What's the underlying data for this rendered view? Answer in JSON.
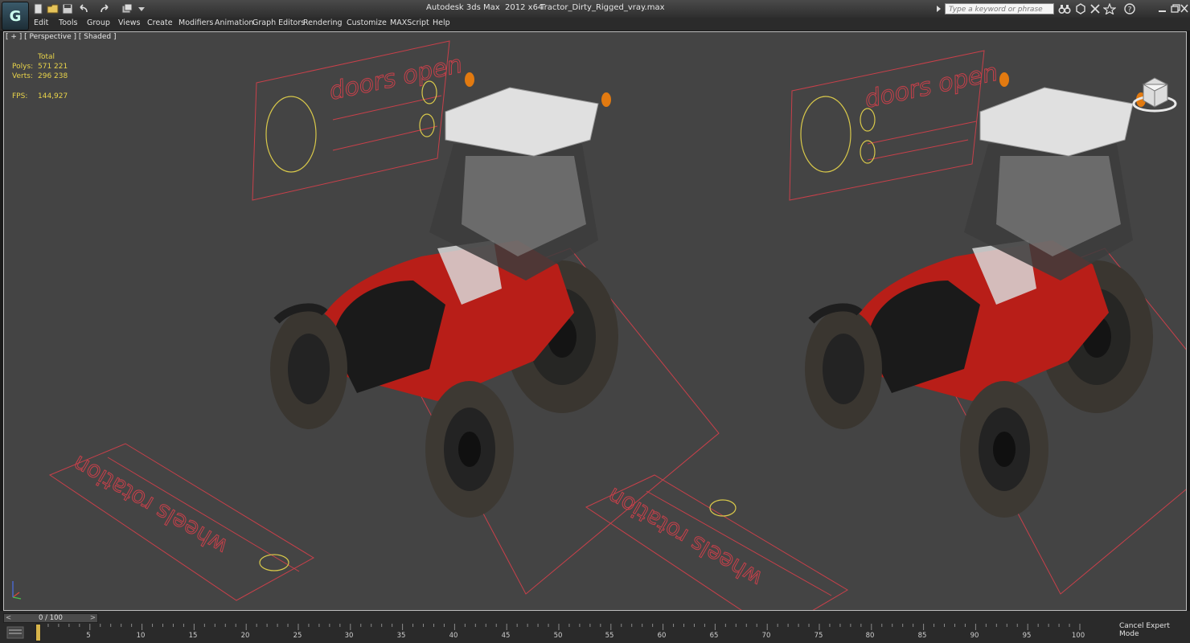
{
  "title": {
    "app": "Autodesk 3ds Max  2012 x64",
    "file": "Tractor_Dirty_Rigged_vray.max",
    "search_placeholder": "Type a keyword or phrase"
  },
  "menu": [
    "Edit",
    "Tools",
    "Group",
    "Views",
    "Create",
    "Modifiers",
    "Animation",
    "Graph Editors",
    "Rendering",
    "Customize",
    "MAXScript",
    "Help"
  ],
  "viewport": {
    "label": "[ + ] [ Perspective ] [ Shaded ]",
    "stats": {
      "total_label": "Total",
      "polys_label": "Polys:",
      "polys_value": "571 221",
      "verts_label": "Verts:",
      "verts_value": "296 238",
      "fps_label": "FPS:",
      "fps_value": "144,927"
    },
    "helper_texts": {
      "doors": "doors open",
      "wheels": "wheels rotation"
    }
  },
  "timeline": {
    "slider_text": "0 / 100",
    "ticks": [
      "5",
      "10",
      "15",
      "20",
      "25",
      "30",
      "35",
      "40",
      "45",
      "50",
      "55",
      "60",
      "65",
      "70",
      "75",
      "80",
      "85",
      "90",
      "95",
      "100"
    ],
    "status": "Cancel Expert Mode"
  },
  "colors": {
    "viewport_bg": "#444444",
    "helper_red": "#c8404a",
    "helper_yellow": "#d8c84a",
    "tractor_red": "#c8201a",
    "stats_yellow": "#e8d34a"
  }
}
